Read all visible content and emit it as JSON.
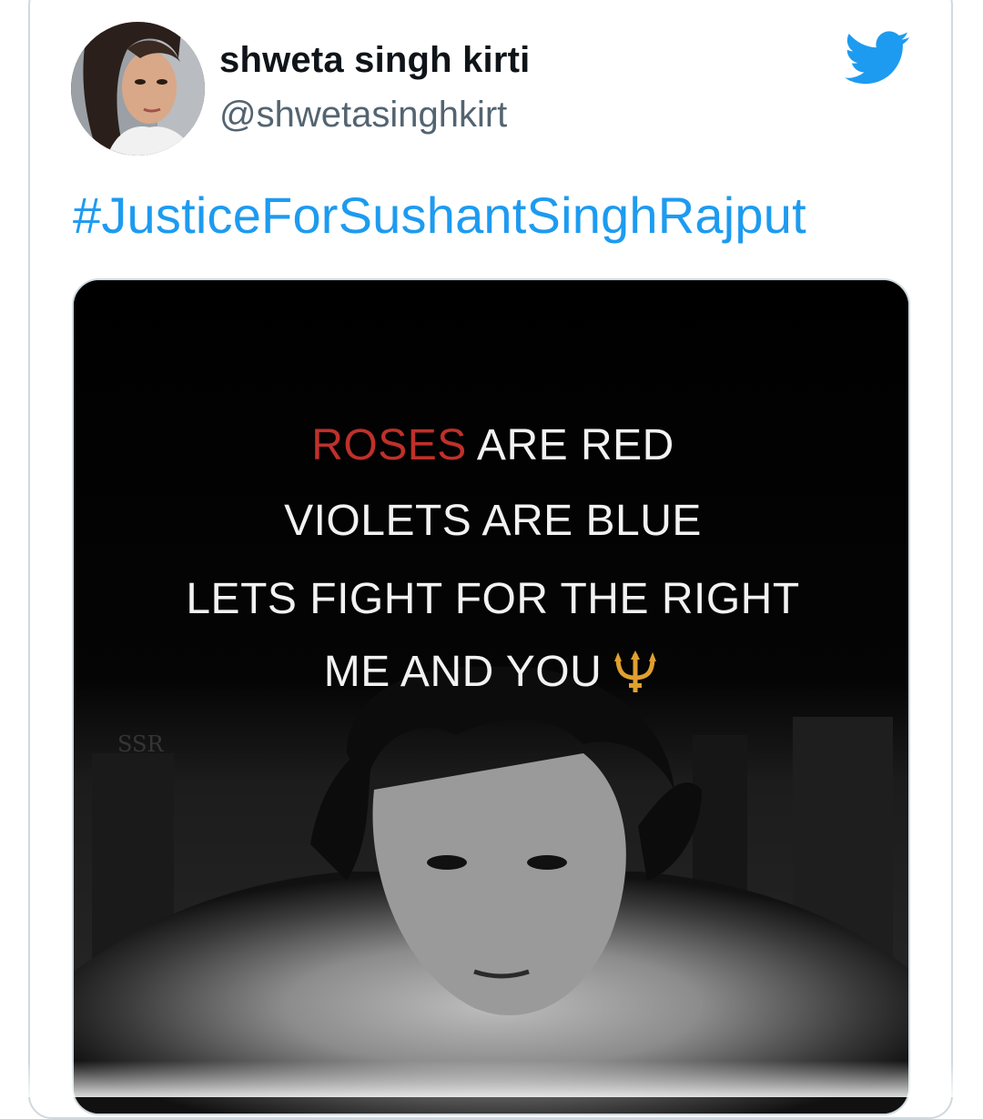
{
  "tweet": {
    "display_name": "shweta singh kirti",
    "handle": "@shwetasinghkirt",
    "hashtag": "#JusticeForSushantSinghRajput",
    "brand_icon": "twitter-bird-icon",
    "brand_color": "#1d9bf0"
  },
  "media": {
    "poem": {
      "line1_red": "ROSES",
      "line1_rest": "ARE RED",
      "line2": "VIOLETS ARE BLUE",
      "line3": "LETS FIGHT FOR THE RIGHT",
      "line4": "ME AND YOU",
      "line4_icon": "trident-emoji-icon"
    },
    "watermark": "SSR",
    "accent_red": "#c0302a"
  }
}
